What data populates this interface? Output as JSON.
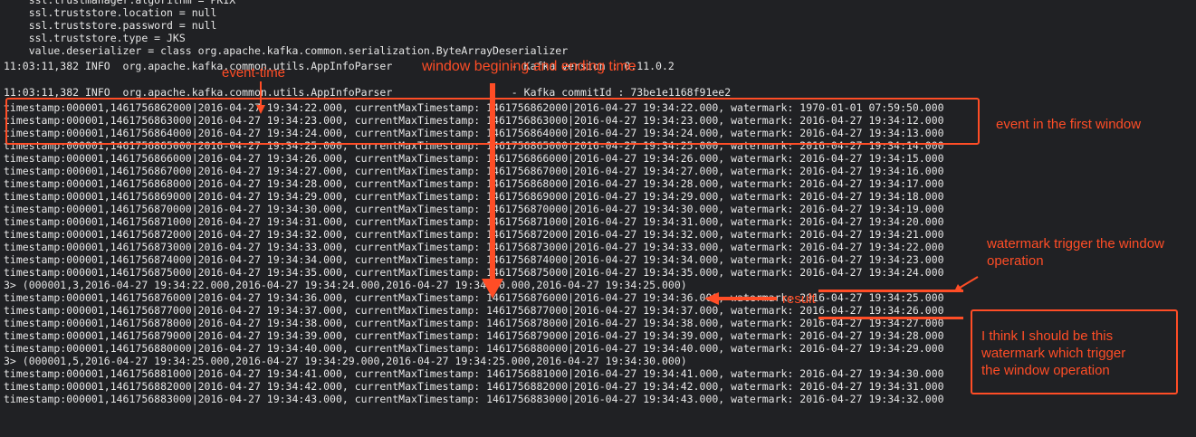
{
  "terminal": {
    "lines": [
      "    ssl.trustmanager.algorithm = PKIX",
      "    ssl.truststore.location = null",
      "    ssl.truststore.password = null",
      "    ssl.truststore.type = JKS",
      "    value.deserializer = class org.apache.kafka.common.serialization.ByteArrayDeserializer",
      "",
      "11:03:11,382 INFO  org.apache.kafka.common.utils.AppInfoParser                   - Kafka version : 0.11.0.2",
      "11:03:11,382 INFO  org.apache.kafka.common.utils.AppInfoParser                   - Kafka commitId : 73be1e1168f91ee2",
      "timestamp:000001,1461756862000|2016-04-27 19:34:22.000, currentMaxTimestamp: 1461756862000|2016-04-27 19:34:22.000, watermark: 1970-01-01 07:59:50.000",
      "timestamp:000001,1461756863000|2016-04-27 19:34:23.000, currentMaxTimestamp: 1461756863000|2016-04-27 19:34:23.000, watermark: 2016-04-27 19:34:12.000",
      "timestamp:000001,1461756864000|2016-04-27 19:34:24.000, currentMaxTimestamp: 1461756864000|2016-04-27 19:34:24.000, watermark: 2016-04-27 19:34:13.000",
      "timestamp:000001,1461756865000|2016-04-27 19:34:25.000, currentMaxTimestamp: 1461756865000|2016-04-27 19:34:25.000, watermark: 2016-04-27 19:34:14.000",
      "timestamp:000001,1461756866000|2016-04-27 19:34:26.000, currentMaxTimestamp: 1461756866000|2016-04-27 19:34:26.000, watermark: 2016-04-27 19:34:15.000",
      "timestamp:000001,1461756867000|2016-04-27 19:34:27.000, currentMaxTimestamp: 1461756867000|2016-04-27 19:34:27.000, watermark: 2016-04-27 19:34:16.000",
      "timestamp:000001,1461756868000|2016-04-27 19:34:28.000, currentMaxTimestamp: 1461756868000|2016-04-27 19:34:28.000, watermark: 2016-04-27 19:34:17.000",
      "timestamp:000001,1461756869000|2016-04-27 19:34:29.000, currentMaxTimestamp: 1461756869000|2016-04-27 19:34:29.000, watermark: 2016-04-27 19:34:18.000",
      "timestamp:000001,1461756870000|2016-04-27 19:34:30.000, currentMaxTimestamp: 1461756870000|2016-04-27 19:34:30.000, watermark: 2016-04-27 19:34:19.000",
      "timestamp:000001,1461756871000|2016-04-27 19:34:31.000, currentMaxTimestamp: 1461756871000|2016-04-27 19:34:31.000, watermark: 2016-04-27 19:34:20.000",
      "timestamp:000001,1461756872000|2016-04-27 19:34:32.000, currentMaxTimestamp: 1461756872000|2016-04-27 19:34:32.000, watermark: 2016-04-27 19:34:21.000",
      "timestamp:000001,1461756873000|2016-04-27 19:34:33.000, currentMaxTimestamp: 1461756873000|2016-04-27 19:34:33.000, watermark: 2016-04-27 19:34:22.000",
      "timestamp:000001,1461756874000|2016-04-27 19:34:34.000, currentMaxTimestamp: 1461756874000|2016-04-27 19:34:34.000, watermark: 2016-04-27 19:34:23.000",
      "timestamp:000001,1461756875000|2016-04-27 19:34:35.000, currentMaxTimestamp: 1461756875000|2016-04-27 19:34:35.000, watermark: 2016-04-27 19:34:24.000",
      "3> (000001,3,2016-04-27 19:34:22.000,2016-04-27 19:34:24.000,2016-04-27 19:34:20.000,2016-04-27 19:34:25.000)",
      "timestamp:000001,1461756876000|2016-04-27 19:34:36.000, currentMaxTimestamp: 1461756876000|2016-04-27 19:34:36.000, watermark: 2016-04-27 19:34:25.000",
      "timestamp:000001,1461756877000|2016-04-27 19:34:37.000, currentMaxTimestamp: 1461756877000|2016-04-27 19:34:37.000, watermark: 2016-04-27 19:34:26.000",
      "timestamp:000001,1461756878000|2016-04-27 19:34:38.000, currentMaxTimestamp: 1461756878000|2016-04-27 19:34:38.000, watermark: 2016-04-27 19:34:27.000",
      "timestamp:000001,1461756879000|2016-04-27 19:34:39.000, currentMaxTimestamp: 1461756879000|2016-04-27 19:34:39.000, watermark: 2016-04-27 19:34:28.000",
      "timestamp:000001,1461756880000|2016-04-27 19:34:40.000, currentMaxTimestamp: 1461756880000|2016-04-27 19:34:40.000, watermark: 2016-04-27 19:34:29.000",
      "3> (000001,5,2016-04-27 19:34:25.000,2016-04-27 19:34:29.000,2016-04-27 19:34:25.000,2016-04-27 19:34:30.000)",
      "timestamp:000001,1461756881000|2016-04-27 19:34:41.000, currentMaxTimestamp: 1461756881000|2016-04-27 19:34:41.000, watermark: 2016-04-27 19:34:30.000",
      "timestamp:000001,1461756882000|2016-04-27 19:34:42.000, currentMaxTimestamp: 1461756882000|2016-04-27 19:34:42.000, watermark: 2016-04-27 19:34:31.000",
      "timestamp:000001,1461756883000|2016-04-27 19:34:43.000, currentMaxTimestamp: 1461756883000|2016-04-27 19:34:43.000, watermark: 2016-04-27 19:34:32.000"
    ]
  },
  "annotations": {
    "event_time": "event-time",
    "window_time": "window begining and ending time",
    "first_window": "event in the first window",
    "watermark_trigger_1": "watermark trigger the window",
    "watermark_trigger_2": "operation",
    "result": "result",
    "think_1": "I think I should be this",
    "think_2": " watermark which trigger",
    "think_3": "the window operation"
  },
  "colors": {
    "background": "#202124",
    "text": "#e6e6e6",
    "annotation": "#ff4d26"
  }
}
